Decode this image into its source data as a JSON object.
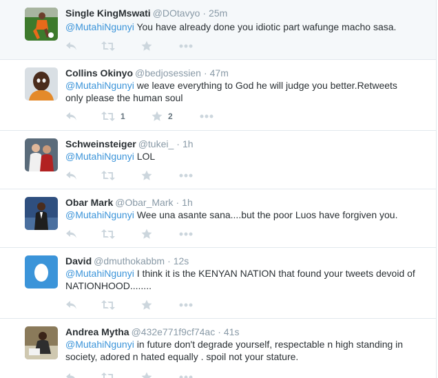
{
  "tweets": [
    {
      "fullname": "Single KingMswati",
      "username": "@DOtavyo",
      "time": "25m",
      "mention": "@MutahiNgunyi",
      "text": " You have already done you idiotic part wafunge macho sasa.",
      "retweets": "",
      "favorites": ""
    },
    {
      "fullname": "Collins Okinyo",
      "username": "@bedjosessien",
      "time": "47m",
      "mention": "@MutahiNgunyi",
      "text": " we leave everything to God he will judge you better.Retweets only please the human soul",
      "retweets": "1",
      "favorites": "2"
    },
    {
      "fullname": "Schweinsteiger",
      "username": "@tukei_",
      "time": "1h",
      "mention": "@MutahiNgunyi",
      "text": " LOL",
      "retweets": "",
      "favorites": ""
    },
    {
      "fullname": "Obar Mark",
      "username": "@Obar_Mark",
      "time": "1h",
      "mention": "@MutahiNgunyi",
      "text": " Wee una asante sana....but the poor Luos have forgiven you.",
      "retweets": "",
      "favorites": ""
    },
    {
      "fullname": "David",
      "username": "@dmuthokabbm",
      "time": "12s",
      "mention": "@MutahiNgunyi",
      "text": " I think it is the KENYAN NATION that found your tweets devoid of NATIONHOOD........",
      "retweets": "",
      "favorites": ""
    },
    {
      "fullname": "Andrea Mytha",
      "username": "@432e771f9cf74ac",
      "time": "41s",
      "mention": "@MutahiNgunyi",
      "text": " in future don't degrade yourself, respectable n high standing in society, adored n hated equally . spoil not your stature.",
      "retweets": "",
      "favorites": ""
    }
  ],
  "icons": {
    "reply": "reply-icon",
    "retweet": "retweet-icon",
    "favorite": "star-icon",
    "more": "more-icon"
  },
  "colors": {
    "link": "#3b94d9",
    "muted": "#8899a6",
    "icon": "#ccd6dd",
    "text": "#292f33"
  }
}
